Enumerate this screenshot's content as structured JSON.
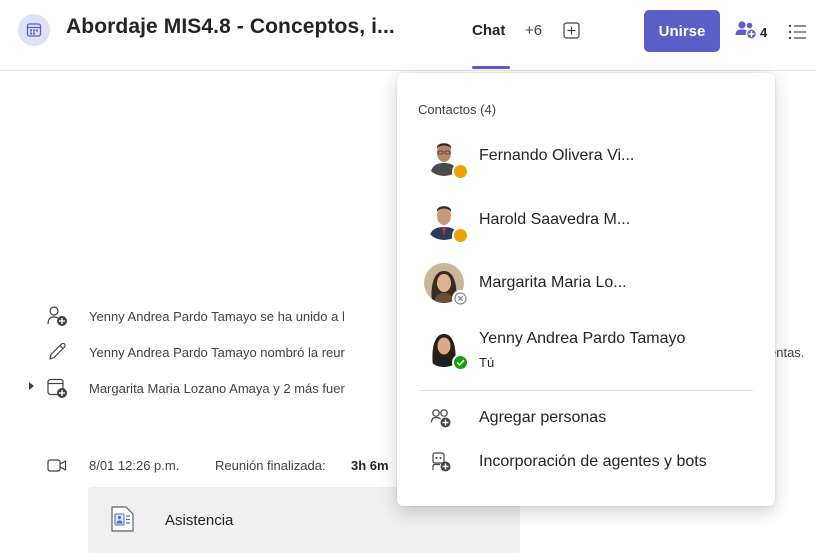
{
  "header": {
    "title": "Abordaje MIS4.8 - Conceptos, i...",
    "tab_chat": "Chat",
    "tab_more": "+6",
    "join_label": "Unirse",
    "participant_count": "4",
    "accent_color": "#5b5fc7"
  },
  "chat": {
    "events": [
      {
        "icon": "person-add-icon",
        "text": "Yenny Andrea Pardo Tamayo se ha unido a l"
      },
      {
        "icon": "pencil-icon",
        "text": "Yenny Andrea Pardo Tamayo nombró la reur"
      },
      {
        "icon": "calendar-add-icon",
        "text": "Margarita Maria Lozano Amaya y 2 más fuer"
      }
    ],
    "trail_text": "entas.",
    "meeting": {
      "time": "8/01 12:26 p.m.",
      "status_label": "Reunión finalizada:",
      "duration": "3h 6m"
    },
    "attendance_label": "Asistencia"
  },
  "contacts_popup": {
    "heading": "Contactos (4)",
    "contacts": [
      {
        "name": "Fernando Olivera Vi...",
        "subtitle": "",
        "presence": "away",
        "presence_color": "#eaa300"
      },
      {
        "name": "Harold Saavedra M...",
        "subtitle": "",
        "presence": "away",
        "presence_color": "#eaa300"
      },
      {
        "name": "Margarita Maria Lo...",
        "subtitle": "",
        "presence": "offline",
        "presence_color": "#8a8a8a"
      },
      {
        "name": "Yenny Andrea Pardo Tamayo",
        "subtitle": "Tú",
        "presence": "available",
        "presence_color": "#13a10e"
      }
    ],
    "actions": [
      {
        "icon": "person-add-icon",
        "label": "Agregar personas"
      },
      {
        "icon": "bot-add-icon",
        "label": "Incorporación de agentes y bots"
      }
    ]
  }
}
